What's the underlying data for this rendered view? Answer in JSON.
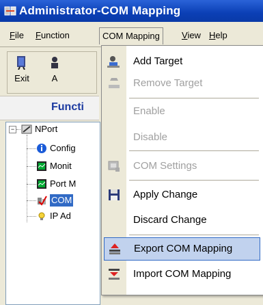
{
  "window": {
    "title": "Administrator-COM Mapping"
  },
  "menubar": [
    {
      "label": "File",
      "u": "F"
    },
    {
      "label": "Function",
      "u": "F"
    },
    {
      "label": "COM Mapping",
      "u": ""
    },
    {
      "label": "View",
      "u": "V"
    },
    {
      "label": "Help",
      "u": "H"
    }
  ],
  "toolbar": {
    "exit_label": "Exit",
    "second_label": "A"
  },
  "function_panel": {
    "header": "Functi"
  },
  "tree": {
    "root": "NPort",
    "children": [
      {
        "label": "Config",
        "icon": "info-icon"
      },
      {
        "label": "Monit",
        "icon": "monitor-icon"
      },
      {
        "label": "Port M",
        "icon": "monitor-icon"
      },
      {
        "label": "COM",
        "icon": "com-mapping-icon",
        "selected": true
      },
      {
        "label": "IP Ad",
        "icon": "bulb-icon"
      }
    ]
  },
  "dropdown": {
    "items": [
      {
        "label": "Add Target",
        "underline": "A",
        "enabled": true,
        "icon": "add-target-icon"
      },
      {
        "label": "Remove Target",
        "underline": "R",
        "enabled": false,
        "icon": "remove-target-icon"
      },
      {
        "label": "Enable",
        "underline": "E",
        "enabled": false,
        "icon": ""
      },
      {
        "label": "Disable",
        "underline": "D",
        "enabled": false,
        "icon": ""
      },
      {
        "label": "COM Settings",
        "underline": "C",
        "enabled": false,
        "icon": "com-settings-icon"
      },
      {
        "label": "Apply Change",
        "underline": "p",
        "enabled": true,
        "icon": "save-icon"
      },
      {
        "label": "Discard Change",
        "underline": "s",
        "enabled": true,
        "icon": ""
      },
      {
        "label": "Export COM Mapping",
        "underline": "x",
        "enabled": true,
        "icon": "export-icon",
        "hover": true
      },
      {
        "label": "Import COM Mapping",
        "underline": "I",
        "enabled": true,
        "icon": "import-icon"
      }
    ]
  }
}
